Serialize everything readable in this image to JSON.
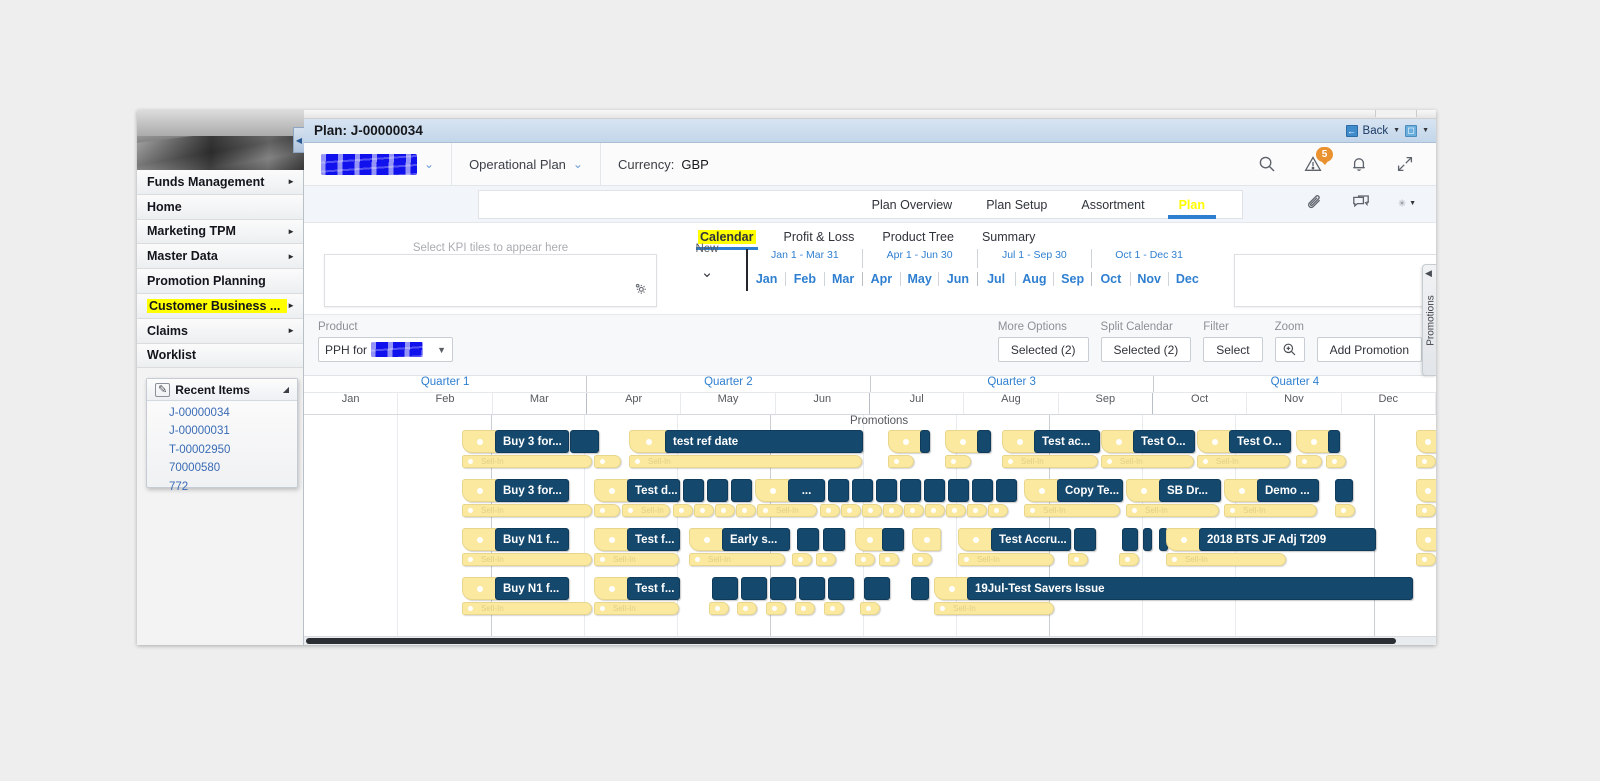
{
  "window": {
    "plan_title": "Plan: J-00000034",
    "back_label": "Back",
    "back_icon": "back-arrow-icon",
    "window_icon": "window-restore-icon"
  },
  "sidebar": {
    "hero_icon": "mountain-road-photo",
    "collapse_icon": "collapse-left-icon",
    "items": [
      {
        "label": "Funds Management",
        "has_arrow": true,
        "highlighted": false
      },
      {
        "label": "Home",
        "has_arrow": false,
        "highlighted": false
      },
      {
        "label": "Marketing TPM",
        "has_arrow": true,
        "highlighted": false
      },
      {
        "label": "Master Data",
        "has_arrow": true,
        "highlighted": false
      },
      {
        "label": "Promotion Planning",
        "has_arrow": false,
        "highlighted": false
      },
      {
        "label": "Customer Business ...",
        "has_arrow": true,
        "highlighted": true
      },
      {
        "label": "Claims",
        "has_arrow": true,
        "highlighted": false
      },
      {
        "label": "Worklist",
        "has_arrow": false,
        "highlighted": false
      }
    ],
    "recent": {
      "title": "Recent Items",
      "icon": "recent-items-icon",
      "collapse_icon": "triangle-collapse-icon",
      "items": [
        "J-00000034",
        "J-00000031",
        "T-00002950",
        "70000580",
        "772"
      ]
    }
  },
  "header": {
    "account_value": "[redacted]",
    "plan_type": "Operational Plan",
    "currency_label": "Currency:",
    "currency_value": "GBP",
    "icons": [
      "search-icon",
      "warning-icon",
      "bell-icon",
      "expand-icon"
    ],
    "warning_count": "5"
  },
  "tabs": {
    "top": [
      {
        "label": "Plan Overview",
        "active": false
      },
      {
        "label": "Plan Setup",
        "active": false
      },
      {
        "label": "Assortment",
        "active": false
      },
      {
        "label": "Plan",
        "active": true
      }
    ],
    "top_icons": [
      "attachment-icon",
      "comments-icon",
      "settings-icon"
    ],
    "sub": [
      {
        "label": "Calendar",
        "active": true
      },
      {
        "label": "Profit & Loss",
        "active": false
      },
      {
        "label": "Product Tree",
        "active": false
      },
      {
        "label": "Summary",
        "active": false
      }
    ]
  },
  "kpi": {
    "placeholder": "Select KPI tiles to appear here",
    "gear_icon": "kpi-settings-gear-icon"
  },
  "period": {
    "new_label": "New",
    "caret_icon": "chevron-down-icon",
    "quarter_ranges": [
      "Jan 1 - Mar 31",
      "Apr 1 - Jun 30",
      "Jul 1 - Sep 30",
      "Oct 1 - Dec 31"
    ],
    "months": [
      "Jan",
      "Feb",
      "Mar",
      "Apr",
      "May",
      "Jun",
      "Jul",
      "Aug",
      "Sep",
      "Oct",
      "Nov",
      "Dec"
    ]
  },
  "toolbar": {
    "product_label": "Product",
    "product_value": "PPH for",
    "more_options_label": "More Options",
    "more_options_value": "Selected (2)",
    "split_calendar_label": "Split Calendar",
    "split_calendar_value": "Selected (2)",
    "filter_label": "Filter",
    "filter_value": "Select",
    "zoom_label": "Zoom",
    "zoom_icon": "zoom-in-magnifier-icon",
    "add_promotion_label": "Add Promotion"
  },
  "gantt": {
    "promotions_header": "Promotions",
    "quarters": [
      "Quarter 1",
      "Quarter 2",
      "Quarter 3",
      "Quarter 4"
    ],
    "months": [
      "Jan",
      "Feb",
      "Mar",
      "Apr",
      "May",
      "Jun",
      "Jul",
      "Aug",
      "Sep",
      "Oct",
      "Nov",
      "Dec"
    ],
    "sellin_label": "Sell-In",
    "rows": [
      {
        "bars": [
          "Buy 3 for...",
          "test ref date",
          "Test ac...",
          "Test O...",
          "Test O..."
        ]
      },
      {
        "bars": [
          "Buy 3 for...",
          "Test d...",
          "...",
          "Copy Te...",
          "SB Dr...",
          "Demo ..."
        ]
      },
      {
        "bars": [
          "Buy N1 f...",
          "Test f...",
          "Early s...",
          "Test Accru...",
          "2018 BTS JF Adj T209"
        ]
      },
      {
        "bars": [
          "Buy N1 f...",
          "Test f...",
          "19Jul-Test Savers Issue"
        ]
      }
    ],
    "rail_label": "Promotions",
    "rail_caret_icon": "chevron-left-icon"
  },
  "colors": {
    "bar_navy": "#15486d",
    "tag_yellow": "#fbe9a0",
    "accent_blue": "#2f7fd0",
    "highlight_yellow": "#ffff00",
    "annotation_green": "#0c8b2a",
    "redaction_blue": "#1111ee",
    "badge_orange": "#e9922f"
  }
}
